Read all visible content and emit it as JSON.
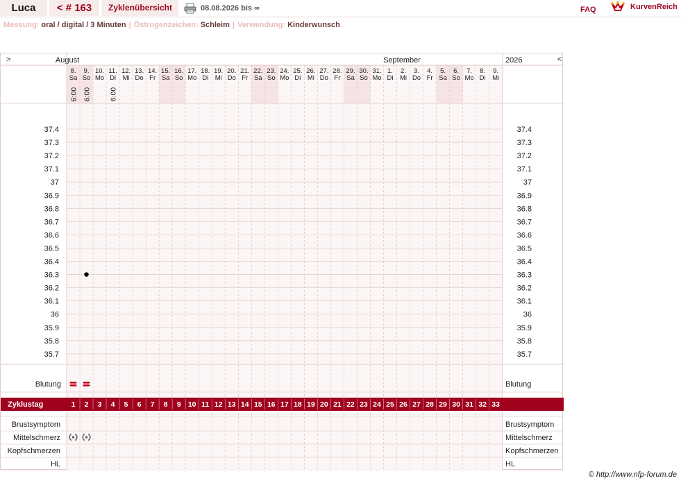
{
  "topbar": {
    "user": "Luca",
    "cycle": "< # 163",
    "overview": "Zyklenübersicht",
    "daterange": "08.08.2026 bis ∞",
    "faq": "FAQ",
    "logo": "KurvenReich",
    "printer_icon": "printer-icon",
    "logo_icon": "crown-logo-icon"
  },
  "info": {
    "measure_label": "Messung:",
    "measure_value": "oral / digital / 3 Minuten",
    "estrogen_label": "Östrogenzeichen:",
    "estrogen_value": "Schleim",
    "usage_label": "Verwendung:",
    "usage_value": "Kinderwunsch"
  },
  "chart": {
    "nav_prev": ">",
    "nav_next": "<",
    "months": [
      "August",
      "September"
    ],
    "year": "2026",
    "days": [
      {
        "d": "8.",
        "w": "Sa",
        "time": "6:00",
        "weekend": true
      },
      {
        "d": "9.",
        "w": "So",
        "time": "6:00",
        "weekend": true
      },
      {
        "d": "10.",
        "w": "Mo",
        "time": "",
        "weekend": false
      },
      {
        "d": "11.",
        "w": "Di",
        "time": "6:00",
        "weekend": false
      },
      {
        "d": "12.",
        "w": "Mi",
        "time": "",
        "weekend": false
      },
      {
        "d": "13.",
        "w": "Do",
        "time": "",
        "weekend": false
      },
      {
        "d": "14.",
        "w": "Fr",
        "time": "",
        "weekend": false
      },
      {
        "d": "15.",
        "w": "Sa",
        "time": "",
        "weekend": true
      },
      {
        "d": "16.",
        "w": "So",
        "time": "",
        "weekend": true
      },
      {
        "d": "17.",
        "w": "Mo",
        "time": "",
        "weekend": false
      },
      {
        "d": "18.",
        "w": "Di",
        "time": "",
        "weekend": false
      },
      {
        "d": "19.",
        "w": "Mi",
        "time": "",
        "weekend": false
      },
      {
        "d": "20.",
        "w": "Do",
        "time": "",
        "weekend": false
      },
      {
        "d": "21.",
        "w": "Fr",
        "time": "",
        "weekend": false
      },
      {
        "d": "22.",
        "w": "Sa",
        "time": "",
        "weekend": true
      },
      {
        "d": "23.",
        "w": "So",
        "time": "",
        "weekend": true
      },
      {
        "d": "24.",
        "w": "Mo",
        "time": "",
        "weekend": false
      },
      {
        "d": "25.",
        "w": "Di",
        "time": "",
        "weekend": false
      },
      {
        "d": "26.",
        "w": "Mi",
        "time": "",
        "weekend": false
      },
      {
        "d": "27.",
        "w": "Do",
        "time": "",
        "weekend": false
      },
      {
        "d": "28.",
        "w": "Fr",
        "time": "",
        "weekend": false
      },
      {
        "d": "29.",
        "w": "Sa",
        "time": "",
        "weekend": true
      },
      {
        "d": "30.",
        "w": "So",
        "time": "",
        "weekend": true
      },
      {
        "d": "31.",
        "w": "Mo",
        "time": "",
        "weekend": false
      },
      {
        "d": "1.",
        "w": "Di",
        "time": "",
        "weekend": false
      },
      {
        "d": "2.",
        "w": "Mi",
        "time": "",
        "weekend": false
      },
      {
        "d": "3.",
        "w": "Do",
        "time": "",
        "weekend": false
      },
      {
        "d": "4.",
        "w": "Fr",
        "time": "",
        "weekend": false
      },
      {
        "d": "5.",
        "w": "Sa",
        "time": "",
        "weekend": true
      },
      {
        "d": "6.",
        "w": "So",
        "time": "",
        "weekend": true
      },
      {
        "d": "7.",
        "w": "Mo",
        "time": "",
        "weekend": false
      },
      {
        "d": "8.",
        "w": "Di",
        "time": "",
        "weekend": false
      },
      {
        "d": "9.",
        "w": "Mi",
        "time": "",
        "weekend": false
      }
    ],
    "temp_labels": [
      "37.4",
      "37.3",
      "37.2",
      "37.1",
      "37",
      "36.9",
      "36.8",
      "36.7",
      "36.6",
      "36.5",
      "36.4",
      "36.3",
      "36.2",
      "36.1",
      "36",
      "35.9",
      "35.8",
      "35.7"
    ],
    "row_labels": {
      "bleeding": "Blutung",
      "cycleday": "Zyklustag",
      "breast": "Brustsymptom",
      "midpain": "Mittelschmerz",
      "headache": "Kopfschmerzen",
      "hl": "HL"
    },
    "cycle_days": [
      "1",
      "2",
      "3",
      "4",
      "5",
      "6",
      "7",
      "8",
      "9",
      "10",
      "11",
      "12",
      "13",
      "14",
      "15",
      "16",
      "17",
      "18",
      "19",
      "20",
      "21",
      "22",
      "23",
      "24",
      "25",
      "26",
      "27",
      "28",
      "29",
      "30",
      "31",
      "32",
      "33"
    ],
    "accent_color": "#a0021e",
    "weekend_color": "#f6e4e4",
    "bleeding_icon": "bleeding-icon",
    "midpain_icon": "midpain-icon"
  },
  "chart_data": {
    "type": "line",
    "xlabel": "",
    "ylabel": "",
    "ylim": [
      35.7,
      37.4
    ],
    "series": [
      {
        "x": [
          "9."
        ],
        "y": [
          36.3
        ]
      }
    ],
    "bleeding_days": [
      "8.",
      "9."
    ],
    "midpain_days": [
      "8.",
      "9."
    ]
  },
  "footer": "© http://www.nfp-forum.de"
}
